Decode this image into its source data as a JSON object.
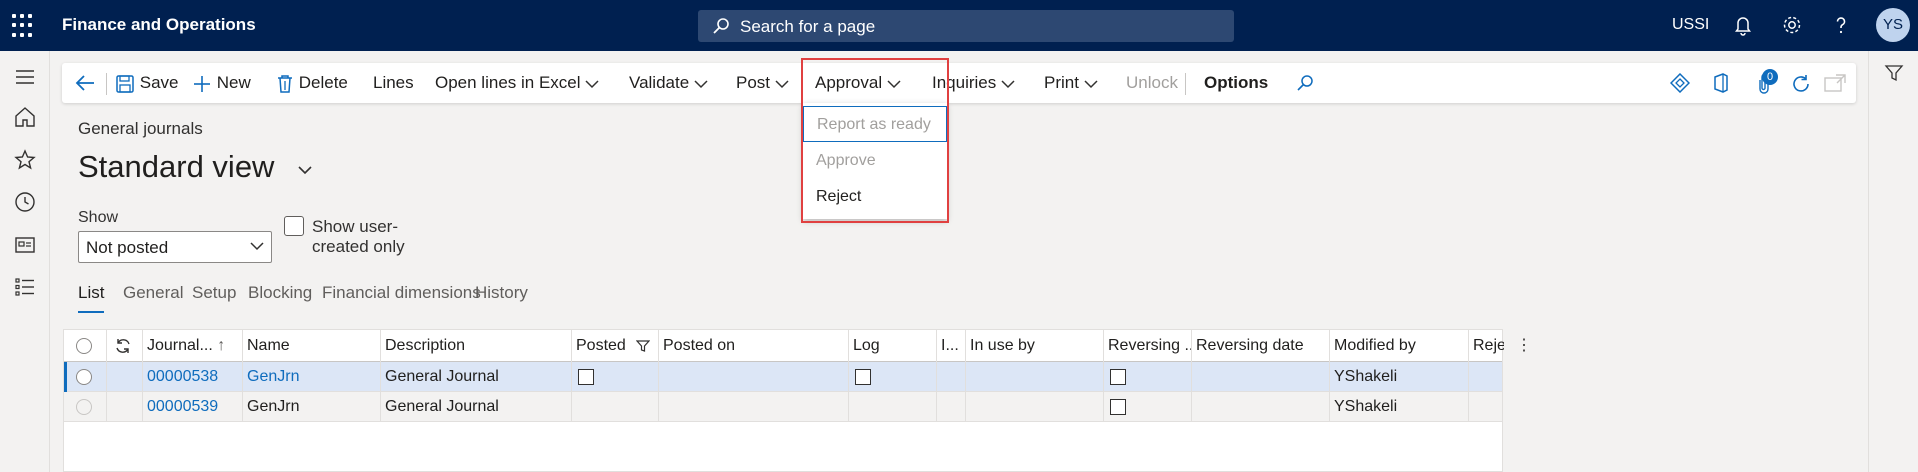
{
  "app": {
    "title": "Finance and Operations",
    "search_placeholder": "Search for a page",
    "company": "USSI",
    "user_initials": "YS"
  },
  "actions": {
    "save": "Save",
    "new": "New",
    "delete": "Delete",
    "lines": "Lines",
    "open_lines_excel": "Open lines in Excel",
    "validate": "Validate",
    "post": "Post",
    "approval": "Approval",
    "inquiries": "Inquiries",
    "print": "Print",
    "unlock": "Unlock",
    "options": "Options",
    "attachments_count": "0"
  },
  "approval_menu": {
    "items": [
      {
        "label": "Report as ready",
        "enabled": false
      },
      {
        "label": "Approve",
        "enabled": false
      },
      {
        "label": "Reject",
        "enabled": true
      }
    ]
  },
  "page": {
    "breadcrumb": "General journals",
    "view_title": "Standard view",
    "show_label": "Show",
    "show_value": "Not posted",
    "show_user_created_label": "Show user-created only"
  },
  "tabs": [
    "List",
    "General",
    "Setup",
    "Blocking",
    "Financial dimensions",
    "History"
  ],
  "grid": {
    "columns": [
      "Journal...",
      "Name",
      "Description",
      "Posted",
      "Posted on",
      "Log",
      "I...",
      "In use by",
      "Reversing ...",
      "Reversing date",
      "Modified by",
      "Reject"
    ],
    "rows": [
      {
        "journal": "00000538",
        "name": "GenJrn",
        "description": "General Journal",
        "modified_by": "YShakeli"
      },
      {
        "journal": "00000539",
        "name": "GenJrn",
        "description": "General Journal",
        "modified_by": "YShakeli"
      }
    ]
  },
  "colors": {
    "topbar": "#002050",
    "accent": "#0f6cbd",
    "highlight": "#e04040"
  }
}
